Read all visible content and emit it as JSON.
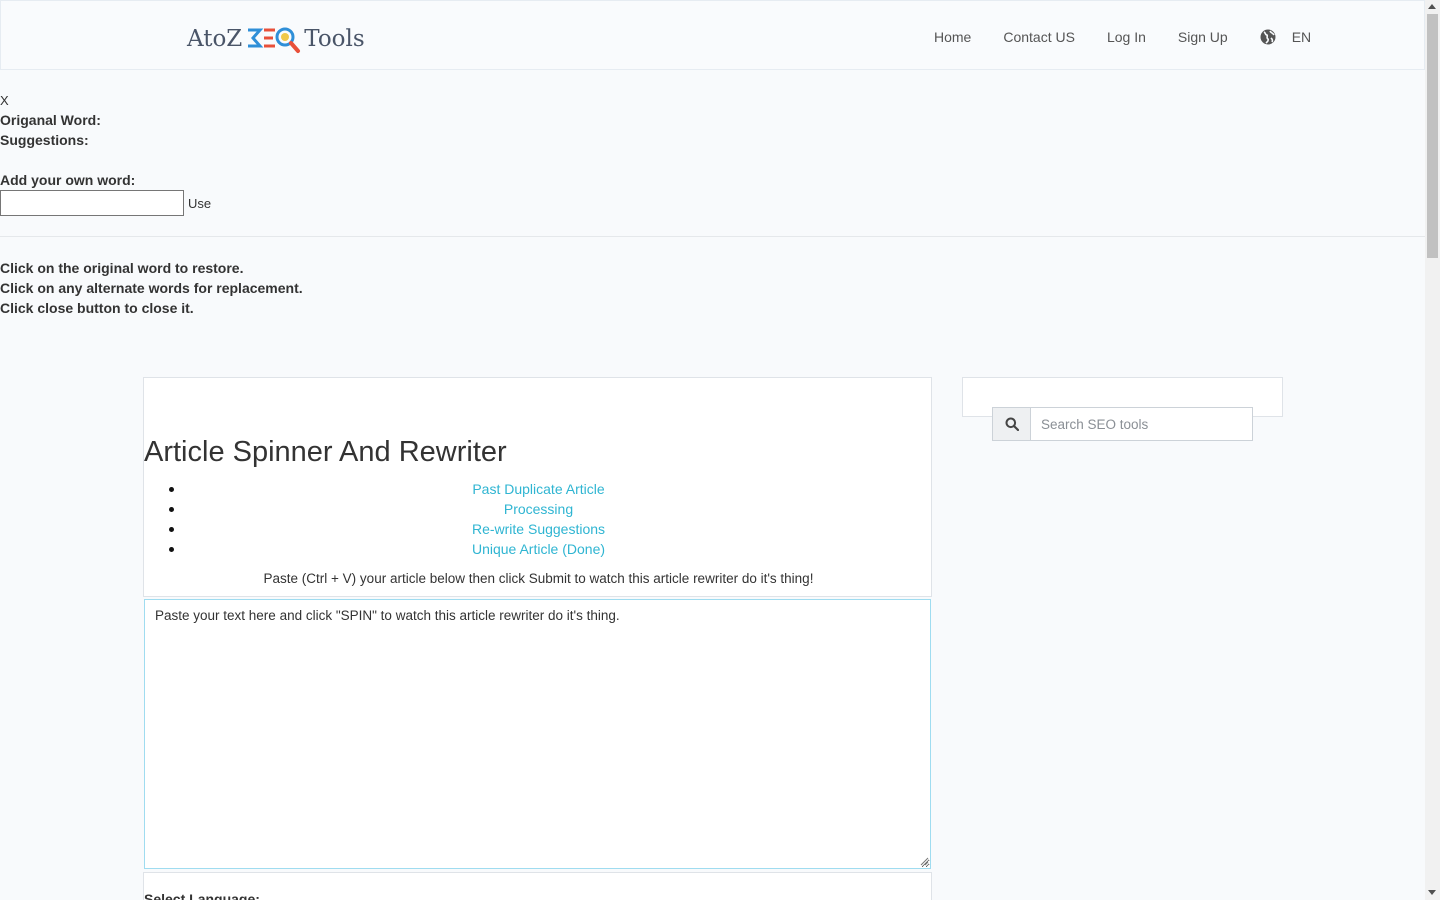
{
  "header": {
    "logo_left": "AtoZ",
    "logo_right": "Tools",
    "nav": [
      "Home",
      "Contact US",
      "Log In",
      "Sign Up"
    ],
    "language": "EN"
  },
  "spinner": {
    "close": "X",
    "original_word_label": "Origanal Word:",
    "suggestions_label": "Suggestions:",
    "add_own_label": "Add your own word:",
    "use_label": "Use"
  },
  "help": [
    "Click on the original word to restore.",
    "Click on any alternate words for replacement.",
    "Click close button to close it."
  ],
  "main": {
    "title": "Article Spinner And Rewriter",
    "steps": [
      "Past Duplicate Article",
      "Processing",
      "Re-write Suggestions",
      "Unique Article (Done)"
    ],
    "paste_note": "Paste (Ctrl + V) your article below then click Submit to watch this article rewriter do it's thing!",
    "textarea_value": "Paste your text here and click \"SPIN\" to watch this article rewriter do it's thing.",
    "select_language_label": "Select Language:"
  },
  "sidebar": {
    "search_placeholder": "Search SEO tools"
  },
  "colors": {
    "link": "#2fb5d2",
    "logo_blue": "#2f8fd8",
    "logo_red": "#e8503a"
  }
}
